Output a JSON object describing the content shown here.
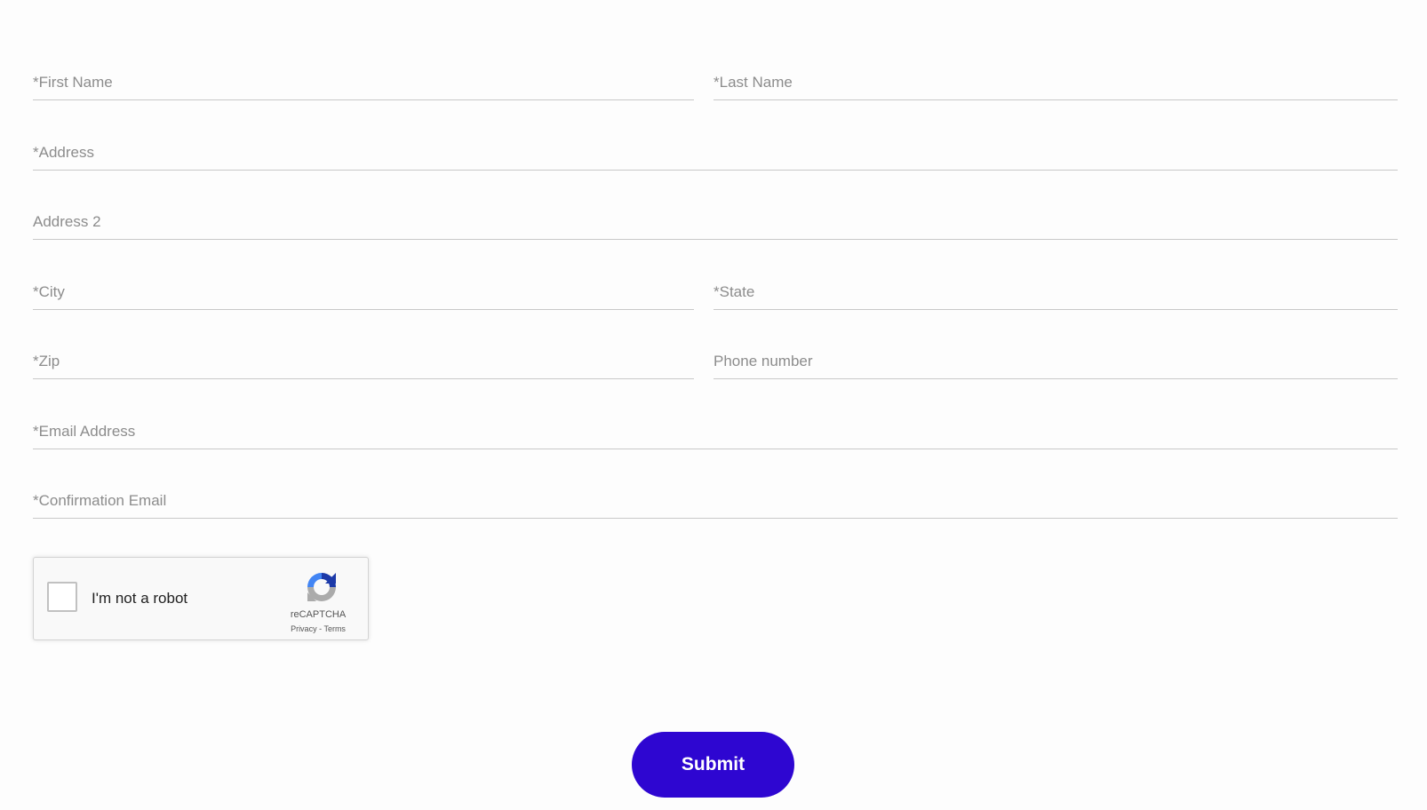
{
  "form": {
    "fields": {
      "first_name": {
        "placeholder": "*First Name",
        "value": ""
      },
      "last_name": {
        "placeholder": "*Last Name",
        "value": ""
      },
      "address": {
        "placeholder": "*Address",
        "value": ""
      },
      "address2": {
        "placeholder": "Address 2",
        "value": ""
      },
      "city": {
        "placeholder": "*City",
        "value": ""
      },
      "state": {
        "placeholder": "*State",
        "value": ""
      },
      "zip": {
        "placeholder": "*Zip",
        "value": ""
      },
      "phone": {
        "placeholder": "Phone number",
        "value": ""
      },
      "email": {
        "placeholder": "*Email Address",
        "value": ""
      },
      "confirm_email": {
        "placeholder": "*Confirmation Email",
        "value": ""
      }
    }
  },
  "recaptcha": {
    "label": "I'm not a robot",
    "brand": "reCAPTCHA",
    "privacy": "Privacy",
    "separator": "-",
    "terms": "Terms",
    "icon": "recaptcha-logo-icon",
    "checked": false
  },
  "submit": {
    "label": "Submit",
    "color": "#2e06d1"
  }
}
